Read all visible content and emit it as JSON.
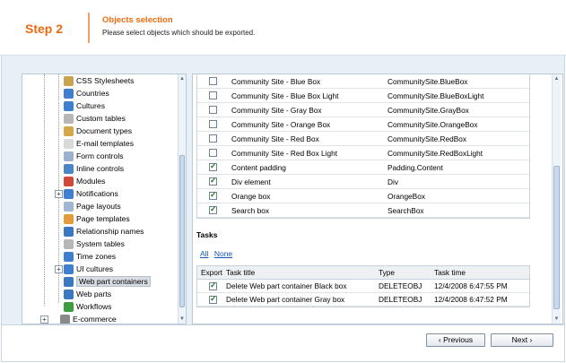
{
  "header": {
    "step": "Step 2",
    "title": "Objects selection",
    "subtitle": "Please select objects which should be exported."
  },
  "tree": {
    "items": [
      {
        "label": "CSS Stylesheets",
        "icon": "css-icon",
        "color": "#c9a34d"
      },
      {
        "label": "Countries",
        "icon": "globe-icon",
        "color": "#3f7fcf"
      },
      {
        "label": "Cultures",
        "icon": "globe-icon",
        "color": "#3f7fcf"
      },
      {
        "label": "Custom tables",
        "icon": "table-icon",
        "color": "#b7b7b7"
      },
      {
        "label": "Document types",
        "icon": "document-types-icon",
        "color": "#d6a64a"
      },
      {
        "label": "E-mail templates",
        "icon": "email-icon",
        "color": "#d9d9d9"
      },
      {
        "label": "Form controls",
        "icon": "form-controls-icon",
        "color": "#9ab2d0"
      },
      {
        "label": "Inline controls",
        "icon": "inline-controls-icon",
        "color": "#4a86c6"
      },
      {
        "label": "Modules",
        "icon": "modules-icon",
        "color": "#d04a3a"
      },
      {
        "label": "Notifications",
        "icon": "notifications-icon",
        "color": "#3f7fcf"
      },
      {
        "label": "Page layouts",
        "icon": "page-layouts-icon",
        "color": "#a0b7d2"
      },
      {
        "label": "Page templates",
        "icon": "page-templates-icon",
        "color": "#e49b3a"
      },
      {
        "label": "Relationship names",
        "icon": "relationship-icon",
        "color": "#3a79c2"
      },
      {
        "label": "System tables",
        "icon": "table-icon",
        "color": "#b7b7b7"
      },
      {
        "label": "Time zones",
        "icon": "clock-icon",
        "color": "#3f7fcf"
      },
      {
        "label": "UI cultures",
        "icon": "globe-icon",
        "color": "#3f7fcf"
      },
      {
        "label": "Web part containers",
        "icon": "web-part-containers-icon",
        "color": "#3a79c2"
      },
      {
        "label": "Web parts",
        "icon": "web-parts-icon",
        "color": "#3a79c2"
      },
      {
        "label": "Workflows",
        "icon": "workflow-icon",
        "color": "#3f9c3f"
      },
      {
        "label": "E-commerce",
        "icon": "ecommerce-icon",
        "color": "#8a8a8a"
      }
    ],
    "selected": "Web part containers"
  },
  "objects": [
    {
      "name": "Community Site - Blue Box",
      "code": "CommunitySite.BlueBox",
      "checked": false
    },
    {
      "name": "Community Site - Blue Box Light",
      "code": "CommunitySite.BlueBoxLight",
      "checked": false
    },
    {
      "name": "Community Site - Gray Box",
      "code": "CommunitySite.GrayBox",
      "checked": false
    },
    {
      "name": "Community Site - Orange Box",
      "code": "CommunitySite.OrangeBox",
      "checked": false
    },
    {
      "name": "Community Site - Red Box",
      "code": "CommunitySite.RedBox",
      "checked": false
    },
    {
      "name": "Community Site - Red Box Light",
      "code": "CommunitySite.RedBoxLight",
      "checked": false
    },
    {
      "name": "Content padding",
      "code": "Padding.Content",
      "checked": true
    },
    {
      "name": "Div element",
      "code": "Div",
      "checked": true
    },
    {
      "name": "Orange box",
      "code": "OrangeBox",
      "checked": true
    },
    {
      "name": "Search box",
      "code": "SearchBox",
      "checked": true
    }
  ],
  "tasks": {
    "title": "Tasks",
    "all_link": "All",
    "none_link": "None",
    "columns": {
      "export": "Export",
      "title": "Task title",
      "type": "Type",
      "time": "Task time"
    },
    "rows": [
      {
        "title": "Delete Web part container Black box",
        "type": "DELETEOBJ",
        "time": "12/4/2008 6:47:55 PM",
        "checked": true
      },
      {
        "title": "Delete Web part container Gray box",
        "type": "DELETEOBJ",
        "time": "12/4/2008 6:47:52 PM",
        "checked": true
      }
    ]
  },
  "footer": {
    "previous_label": "Previous",
    "next_label": "Next"
  }
}
